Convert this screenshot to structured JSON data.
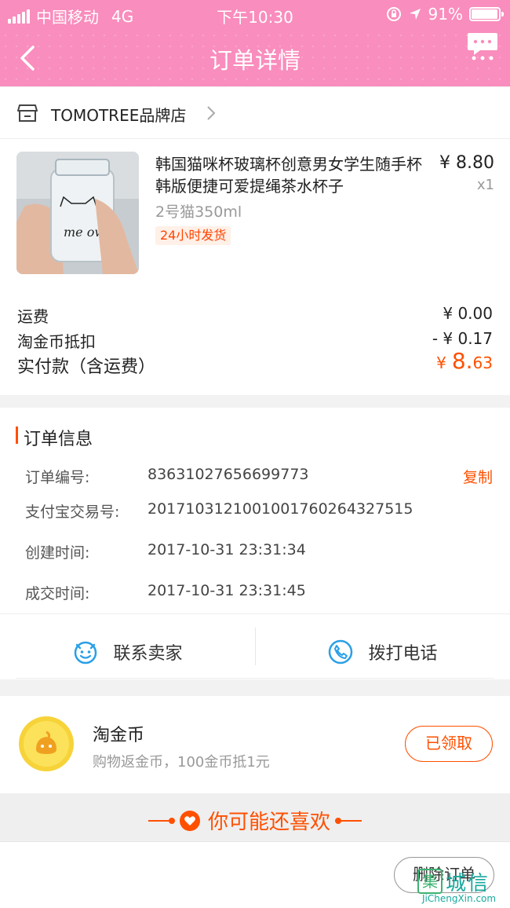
{
  "status_bar": {
    "carrier": "中国移动",
    "network": "4G",
    "time": "下午10:30",
    "battery": "91%",
    "battery_level": 0.91
  },
  "nav": {
    "title": "订单详情"
  },
  "shop": {
    "name": "TOMOTREE品牌店"
  },
  "product": {
    "title": "韩国猫咪杯玻璃杯创意男女学生随手杯韩版便捷可爱提绳茶水杯子",
    "price": "¥ 8.80",
    "qty": "x1",
    "spec": "2号猫350ml",
    "tag": "24小时发货",
    "image_text": "me ow"
  },
  "fees": {
    "shipping_label": "运费",
    "shipping_value": "¥ 0.00",
    "coin_label": "淘金币抵扣",
    "coin_value": "- ¥ 0.17",
    "total_label": "实付款（含运费）",
    "total_currency": "¥",
    "total_int": "8.",
    "total_dec": "63"
  },
  "order_info": {
    "title": "订单信息",
    "rows": [
      {
        "label": "订单编号:",
        "value": "83631027656699773",
        "action": "复制"
      },
      {
        "label": "支付宝交易号:",
        "value": "2017103121001001760264327515"
      },
      {
        "label": "创建时间:",
        "value": "2017-10-31 23:31:34"
      },
      {
        "label": "成交时间:",
        "value": "2017-10-31 23:31:45"
      }
    ],
    "contact_seller": "联系卖家",
    "call_phone": "拨打电话"
  },
  "coin": {
    "title": "淘金币",
    "subtitle": "购物返金币，100金币抵1元",
    "button": "已领取"
  },
  "recommend": {
    "title": "你可能还喜欢"
  },
  "bottom": {
    "delete_button": "删除订单"
  },
  "watermark": {
    "main": "城信",
    "url": "JiChengXin.com",
    "box": "集"
  },
  "colors": {
    "nav_pink": "#f98dbd",
    "accent_orange": "#ff5000"
  }
}
